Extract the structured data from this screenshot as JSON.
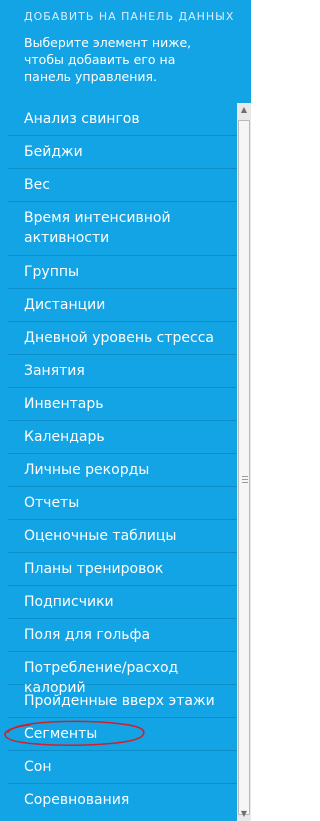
{
  "header": {
    "title": "ДОБАВИТЬ НА ПАНЕЛЬ ДАННЫХ",
    "description": "Выберите элемент ниже, чтобы добавить его на панель управления."
  },
  "items": [
    {
      "label": "Анализ свингов"
    },
    {
      "label": "Бейджи"
    },
    {
      "label": "Вес"
    },
    {
      "label": "Время интенсивной активности"
    },
    {
      "label": "Группы"
    },
    {
      "label": "Дистанции"
    },
    {
      "label": "Дневной уровень стресса"
    },
    {
      "label": "Занятия"
    },
    {
      "label": "Инвентарь"
    },
    {
      "label": "Календарь"
    },
    {
      "label": "Личные рекорды"
    },
    {
      "label": "Отчеты"
    },
    {
      "label": "Оценочные таблицы"
    },
    {
      "label": "Планы тренировок"
    },
    {
      "label": "Подписчики"
    },
    {
      "label": "Поля для гольфа"
    },
    {
      "label": "Потребление/расход калорий"
    },
    {
      "label": "Пройденные вверх этажи"
    },
    {
      "label": "Сегменты",
      "highlighted": true
    },
    {
      "label": "Сон"
    },
    {
      "label": "Соревнования"
    }
  ],
  "colors": {
    "background": "#13a4e6",
    "divider": "#0c8ecb",
    "text": "#ffffff",
    "annotation": "#d0202a"
  },
  "icons": {
    "scroll_up": "up-arrow-icon",
    "scroll_down": "down-arrow-icon",
    "grip": "grip-icon"
  }
}
